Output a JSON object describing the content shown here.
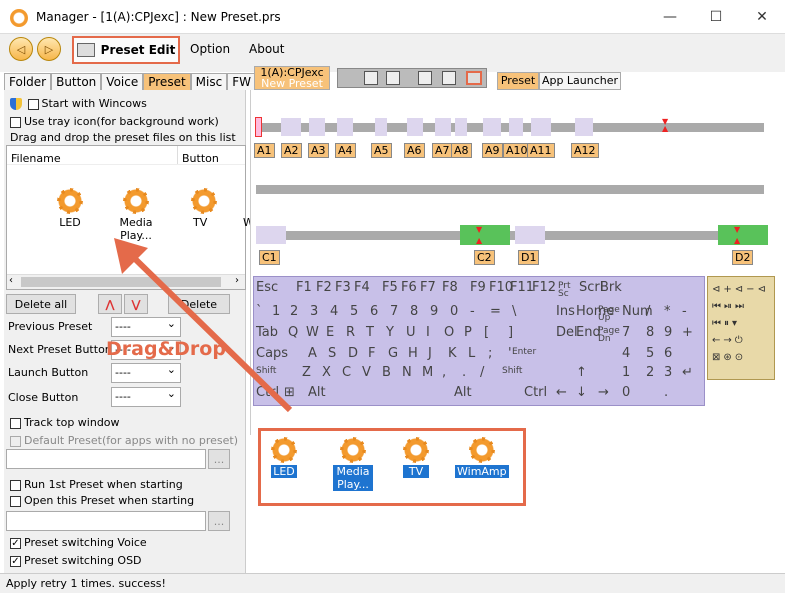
{
  "window": {
    "title": "Manager - [1(A):CPJexc] : New Preset.prs",
    "minimize": "—",
    "maximize": "☐",
    "close": "✕"
  },
  "toolbar": {
    "back": "◁",
    "forward": "▷",
    "preset_edit": "Preset Edit",
    "menu_option": "Option",
    "menu_about": "About"
  },
  "left_tabs": [
    "Folder",
    "Button",
    "Voice",
    "Preset",
    "Misc",
    "FW"
  ],
  "left": {
    "start_with_windows": "Start with Wincows",
    "tray_icon": "Use tray icon(for background work)",
    "drag_hint": "Drag and drop the preset files on this list",
    "col_filename": "Filename",
    "col_button": "Button",
    "files": [
      {
        "name": "LED"
      },
      {
        "name": "Media Play..."
      },
      {
        "name": "TV"
      },
      {
        "name": "WimAmp"
      }
    ],
    "delete_all": "Delete all",
    "up": "⋀",
    "down": "⋁",
    "delete": "Delete",
    "previous_preset": "Previous Preset",
    "next_preset_button": "Next Preset Button",
    "launch_button": "Launch Button",
    "close_button": "Close Button",
    "combo_value": "----",
    "track_top_window": "Track top window",
    "default_preset": "Default Preset(for apps with no preset)",
    "browse": "...",
    "run_first_preset": "Run 1st Preset when starting",
    "open_this_preset": "Open this Preset when starting",
    "voice_switching": "Preset switching Voice",
    "osd_switching": "Preset switching OSD",
    "check_mark": "✓"
  },
  "status": {
    "text": "Apply retry  1 times. success!"
  },
  "right_tabs": {
    "device_tab_line1": "1(A):CPJexc",
    "device_tab_line2": "New Preset",
    "preset_tab": "Preset",
    "launcher_tab": "App Launcher"
  },
  "timeline": {
    "a_labels": [
      "A1",
      "A2",
      "A3",
      "A4",
      "A5",
      "A6",
      "A7",
      "A8",
      "A9",
      "A10",
      "A11",
      "A12"
    ],
    "c_labels": [
      "C1",
      "C2"
    ],
    "d_labels": [
      "D1",
      "D2"
    ]
  },
  "annotation": {
    "drag_drop": "Drag&Drop"
  },
  "keyboard": {
    "row1": [
      "Esc",
      "F1",
      "F2",
      "F3",
      "F4",
      "F5",
      "F6",
      "F7",
      "F8",
      "F9",
      "F10",
      "F11",
      "F12",
      "Prt Sc",
      "Scrl",
      "Brk"
    ],
    "row2": [
      "`",
      "1",
      "2",
      "3",
      "4",
      "5",
      "6",
      "7",
      "8",
      "9",
      "0",
      "-",
      "=",
      "\\",
      "Ins",
      "Home",
      "Page Up",
      "Num",
      "/",
      "*",
      "-"
    ],
    "row3": [
      "Tab",
      "Q",
      "W",
      "E",
      "R",
      "T",
      "Y",
      "U",
      "I",
      "O",
      "P",
      "[",
      "]",
      "Del",
      "End",
      "Page Dn",
      "7",
      "8",
      "9",
      "+"
    ],
    "row4": [
      "Caps",
      "A",
      "S",
      "D",
      "F",
      "G",
      "H",
      "J",
      "K",
      "L",
      ";",
      "'",
      "Enter",
      "4",
      "5",
      "6"
    ],
    "row5": [
      "Shift",
      "Z",
      "X",
      "C",
      "V",
      "B",
      "N",
      "M",
      ",",
      ".",
      "/",
      "Shift",
      "↑",
      "1",
      "2",
      "3",
      "↵"
    ],
    "row6": [
      "Ctrl",
      "⊞",
      "Alt",
      "Alt",
      "Ctrl",
      "←",
      "↓",
      "→",
      "0",
      "."
    ]
  },
  "colors": {
    "accent": "#f7c27a",
    "highlight": "#e46a4a",
    "selection": "#1e74d0"
  }
}
